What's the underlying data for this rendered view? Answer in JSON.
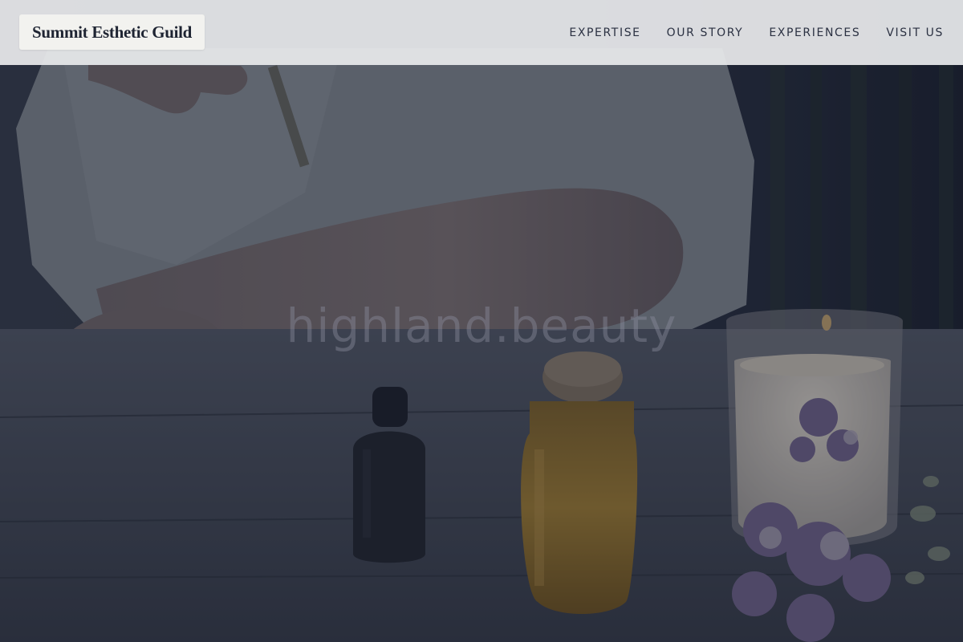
{
  "brand": {
    "name": "Summit Esthetic Guild"
  },
  "nav": {
    "items": [
      {
        "label": "EXPERTISE"
      },
      {
        "label": "OUR STORY"
      },
      {
        "label": "EXPERIENCES"
      },
      {
        "label": "VISIT US"
      }
    ]
  },
  "hero": {
    "watermark": "highland.beauty",
    "image_icon": "hero-photo-oils-candle-flowers"
  }
}
